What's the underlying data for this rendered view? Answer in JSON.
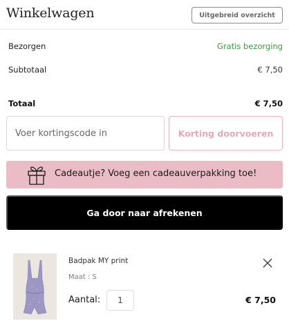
{
  "header": {
    "title": "Winkelwagen",
    "overview_button": "Uitgebreid overzicht"
  },
  "summary": {
    "delivery_label": "Bezorgen",
    "delivery_value": "Gratis bezorging",
    "subtotal_label": "Subtotaal",
    "subtotal_value": "€ 7,50",
    "total_label": "Totaal",
    "total_value": "€ 7,50"
  },
  "discount": {
    "placeholder": "Voer kortingscode in",
    "apply_button": "Korting doorvoeren"
  },
  "gift": {
    "text": "Cadeautje? Voeg een cadeauverpakking toe!",
    "icon": "gift-icon"
  },
  "checkout": {
    "button": "Ga door naar afrekenen"
  },
  "cart_items": [
    {
      "name": "Badpak MY print",
      "size": "Maat : S",
      "quantity_label": "Aantal:",
      "quantity": "1",
      "price": "€ 7,50",
      "remove_icon": "close-icon",
      "swimsuit_color": "#9c97c4"
    }
  ],
  "colors": {
    "accent_pink": "#e9bcc6",
    "discount_button_text": "#e4a8b8",
    "delivery_green": "#3b9a3b",
    "checkout_bg": "#000000"
  }
}
